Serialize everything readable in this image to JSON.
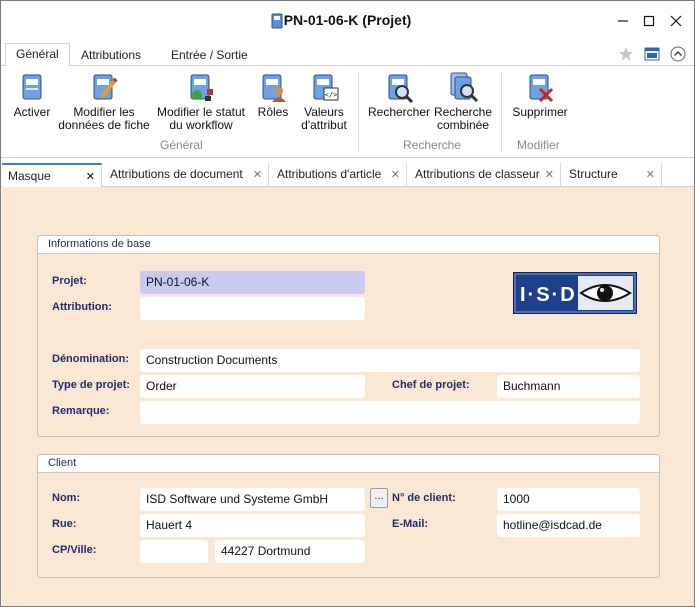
{
  "window": {
    "title": "PN-01-06-K (Projet)"
  },
  "ribbon_tabs": [
    "Général",
    "Attributions",
    "Entrée / Sortie"
  ],
  "ribbon": {
    "activer": "Activer",
    "modifier_donnees_l1": "Modifier les",
    "modifier_donnees_l2": "données de fiche",
    "modifier_statut_l1": "Modifier le statut",
    "modifier_statut_l2": "du workflow",
    "roles": "Rôles",
    "valeurs_l1": "Valeurs",
    "valeurs_l2": "d'attribut",
    "rechercher": "Rechercher",
    "recherche_comb_l1": "Recherche",
    "recherche_comb_l2": "combinée",
    "supprimer": "Supprimer",
    "groups": {
      "general": "Général",
      "recherche": "Recherche",
      "modifier": "Modifier"
    }
  },
  "doc_tabs": [
    "Masque",
    "Attributions de document",
    "Attributions d'article",
    "Attributions de classeur",
    "Structure"
  ],
  "basic": {
    "heading": "Informations de base",
    "projet_label": "Projet:",
    "projet_value": "PN-01-06-K",
    "attribution_label": "Attribution:",
    "attribution_value": "",
    "denomination_label": "Dénomination:",
    "denomination_value": "Construction Documents",
    "type_label": "Type de projet:",
    "type_value": "Order",
    "chef_label": "Chef de projet:",
    "chef_value": "Buchmann",
    "remarque_label": "Remarque:",
    "remarque_value": "",
    "logo_text": "I·S·D"
  },
  "client": {
    "heading": "Client",
    "nom_label": "Nom:",
    "nom_value": "ISD Software und Systeme GmbH",
    "browse_label": "...",
    "num_label": "N° de client:",
    "num_value": "1000",
    "rue_label": "Rue:",
    "rue_value": "Hauert 4",
    "email_label": "E-Mail:",
    "email_value": "hotline@isdcad.de",
    "cp_label": "CP/Ville:",
    "cp_value": "",
    "ville_value": "44227 Dortmund"
  }
}
